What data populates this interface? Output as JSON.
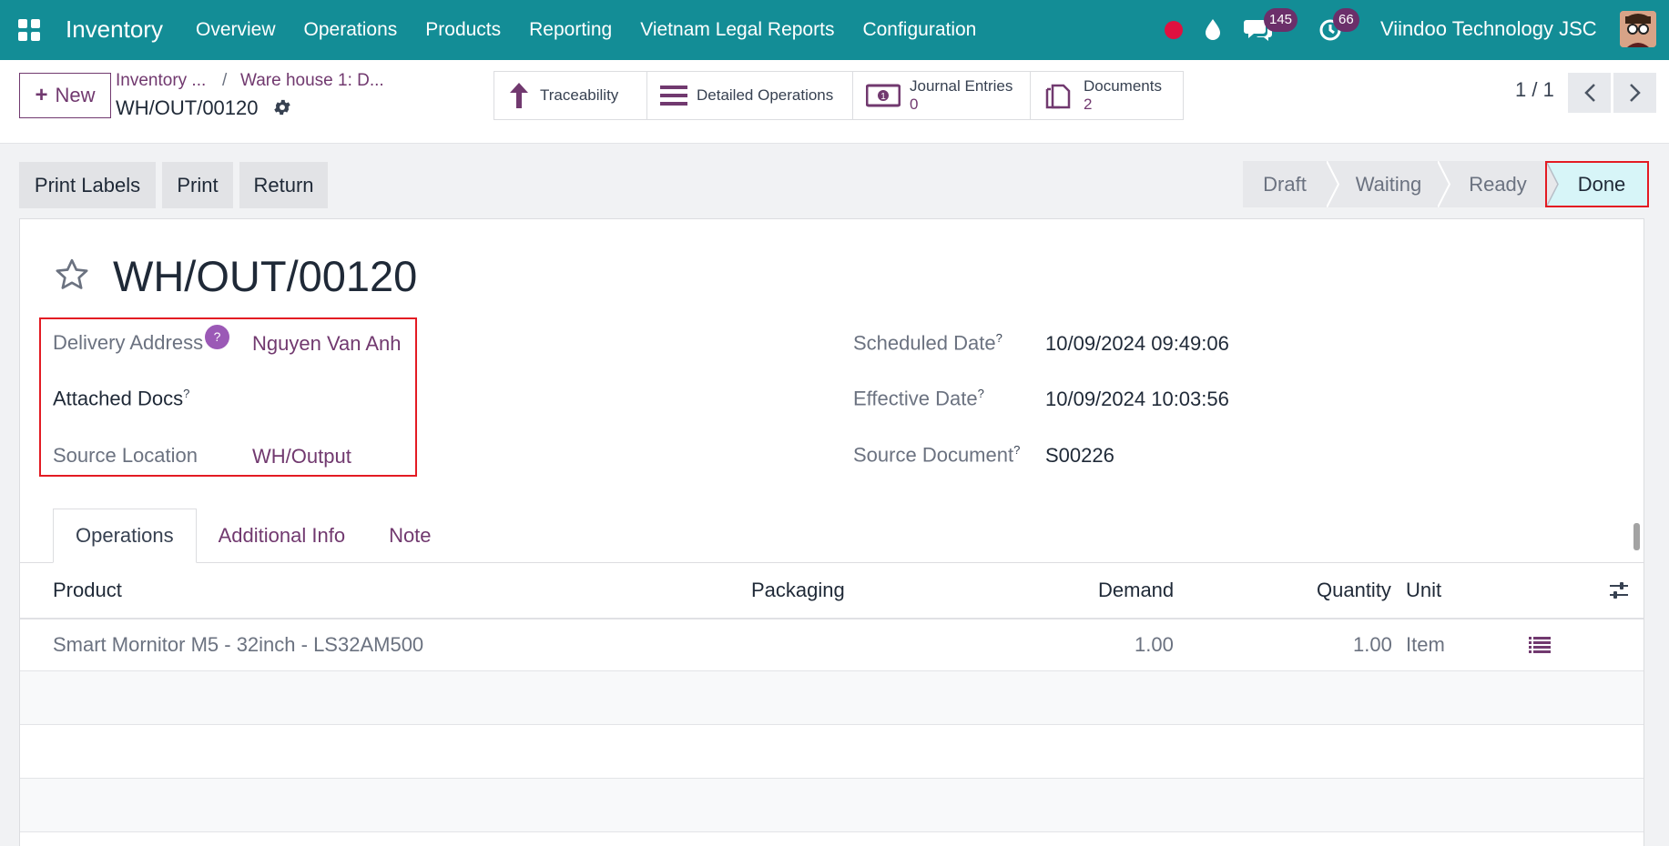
{
  "navbar": {
    "app_name": "Inventory",
    "menu": [
      "Overview",
      "Operations",
      "Products",
      "Reporting",
      "Vietnam Legal Reports",
      "Configuration"
    ],
    "chat_count": "145",
    "activity_count": "66",
    "company": "Viindoo Technology JSC"
  },
  "control_panel": {
    "new_label": "New",
    "breadcrumb_1": "Inventory ...",
    "breadcrumb_sep": "/",
    "breadcrumb_2": "Ware house 1: D...",
    "record_name": "WH/OUT/00120",
    "smart_buttons": {
      "traceability": "Traceability",
      "detailed_operations": "Detailed Operations",
      "journal_entries": "Journal Entries",
      "journal_entries_count": "0",
      "documents": "Documents",
      "documents_count": "2"
    },
    "pager": "1 / 1"
  },
  "actions": {
    "print_labels": "Print Labels",
    "print": "Print",
    "return": "Return"
  },
  "status_stages": [
    "Draft",
    "Waiting",
    "Ready",
    "Done"
  ],
  "status_current": "Done",
  "form": {
    "title": "WH/OUT/00120",
    "help_mark": "?",
    "tooltip_mark": "?",
    "delivery_address_label": "Delivery Address",
    "delivery_address": "Nguyen Van Anh",
    "attached_docs_label": "Attached Docs",
    "source_location_label": "Source Location",
    "source_location": "WH/Output",
    "scheduled_date_label": "Scheduled Date",
    "scheduled_date": "10/09/2024 09:49:06",
    "effective_date_label": "Effective Date",
    "effective_date": "10/09/2024 10:03:56",
    "source_document_label": "Source Document",
    "source_document": "S00226"
  },
  "tabs": [
    "Operations",
    "Additional Info",
    "Note"
  ],
  "table": {
    "headers": {
      "product": "Product",
      "packaging": "Packaging",
      "demand": "Demand",
      "quantity": "Quantity",
      "unit": "Unit"
    },
    "rows": [
      {
        "product": "Smart Mornitor M5 - 32inch - LS32AM500",
        "packaging": "",
        "demand": "1.00",
        "quantity": "1.00",
        "unit": "Item"
      }
    ]
  },
  "colors": {
    "navbar": "#138d96",
    "accent": "#71396f",
    "highlight": "#e31b23",
    "done_stage": "#d7f5f8"
  }
}
